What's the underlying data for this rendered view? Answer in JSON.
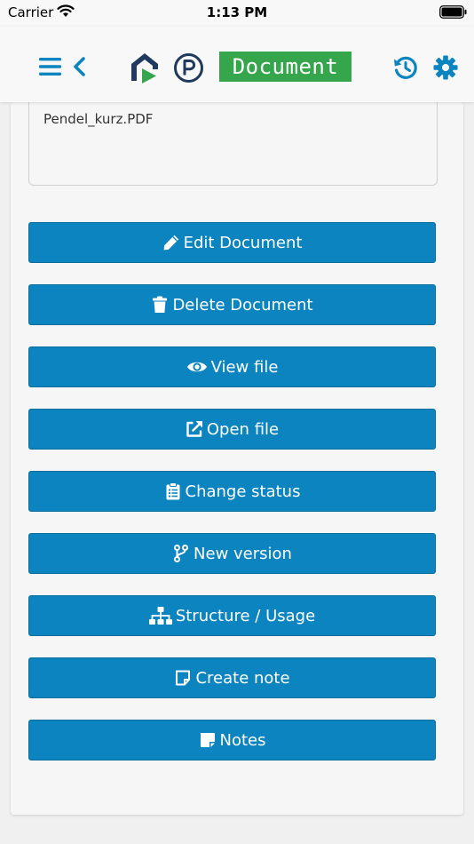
{
  "status_bar": {
    "carrier": "Carrier",
    "time": "1:13 PM"
  },
  "header": {
    "title": "Document"
  },
  "document": {
    "file_name": "Pendel_kurz.PDF"
  },
  "actions": [
    {
      "label": "Edit Document",
      "icon": "pencil-icon"
    },
    {
      "label": "Delete Document",
      "icon": "trash-icon"
    },
    {
      "label": "View file",
      "icon": "eye-icon"
    },
    {
      "label": "Open file",
      "icon": "external-link-icon"
    },
    {
      "label": "Change status",
      "icon": "clipboard-list-icon"
    },
    {
      "label": "New version",
      "icon": "code-branch-icon"
    },
    {
      "label": "Structure / Usage",
      "icon": "sitemap-icon"
    },
    {
      "label": "Create note",
      "icon": "sticky-note-outline-icon"
    },
    {
      "label": "Notes",
      "icon": "sticky-note-icon"
    }
  ],
  "colors": {
    "accent": "#0b84bf",
    "title_badge": "#35a64b",
    "logo_dark": "#1f3a5c",
    "logo_green": "#35a64b"
  }
}
